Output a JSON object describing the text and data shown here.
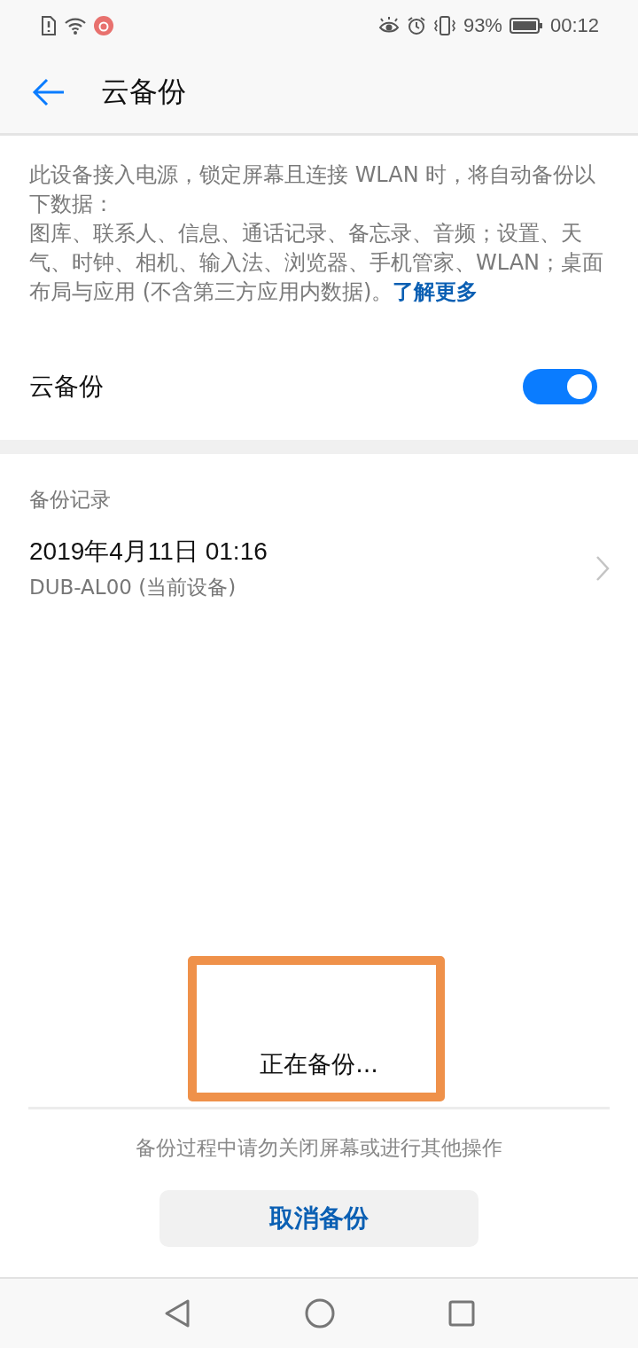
{
  "status_bar": {
    "battery": "93%",
    "time": "00:12"
  },
  "app_bar": {
    "title": "云备份"
  },
  "description": {
    "paragraphs": [
      "此设备接入电源，锁定屏幕且连接 WLAN 时，将自动备份以下数据：",
      "图库、联系人、信息、通话记录、备忘录、音频；设置、天气、时钟、相机、输入法、浏览器、手机管家、WLAN；桌面布局与应用 (不含第三方应用内数据)。"
    ],
    "link": "了解更多"
  },
  "toggle": {
    "label": "云备份",
    "on": true
  },
  "records": {
    "header": "备份记录",
    "items": [
      {
        "title": "2019年4月11日 01:16",
        "subtitle": "DUB-AL00 (当前设备)"
      }
    ]
  },
  "progress": {
    "status": "正在备份...",
    "note": "备份过程中请勿关闭屏幕或进行其他操作",
    "button": "取消备份"
  }
}
